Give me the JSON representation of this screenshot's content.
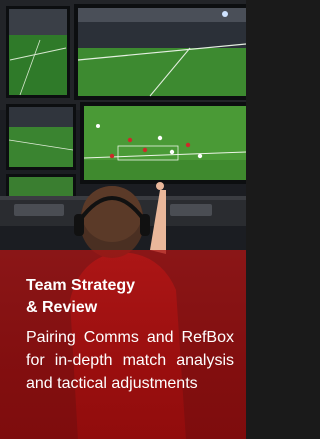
{
  "card": {
    "title_line1": "Team Strategy",
    "title_line2": "& Review",
    "description": "Pairing Comms and RefBox for in-depth match analysis and tactical adjustments"
  },
  "photo": {
    "subject": "operator-with-headset-watching-match-monitors"
  },
  "colors": {
    "overlay": "#a81212",
    "text": "#ffffff",
    "pitch": "#3f8a2e"
  }
}
